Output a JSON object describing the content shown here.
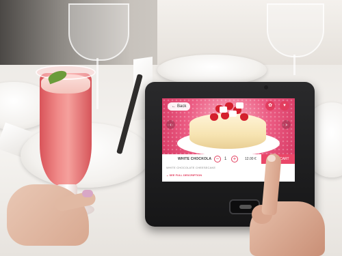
{
  "screen": {
    "back_label": "Back",
    "back_icon": "arrow-left-icon",
    "top_icons": [
      "gift-icon",
      "cart-icon"
    ],
    "product_name": "WHITE CHOCKOLA",
    "subtitle": "WHITE CHOCOLATE CHEESECAKE",
    "quantity": "1",
    "minus_symbol": "−",
    "plus_symbol": "+",
    "price": "12.00 €",
    "cart_label": "ADD CART",
    "description_label": "SEE FULL DESCRIPTION",
    "accent_color": "#ea4668"
  }
}
